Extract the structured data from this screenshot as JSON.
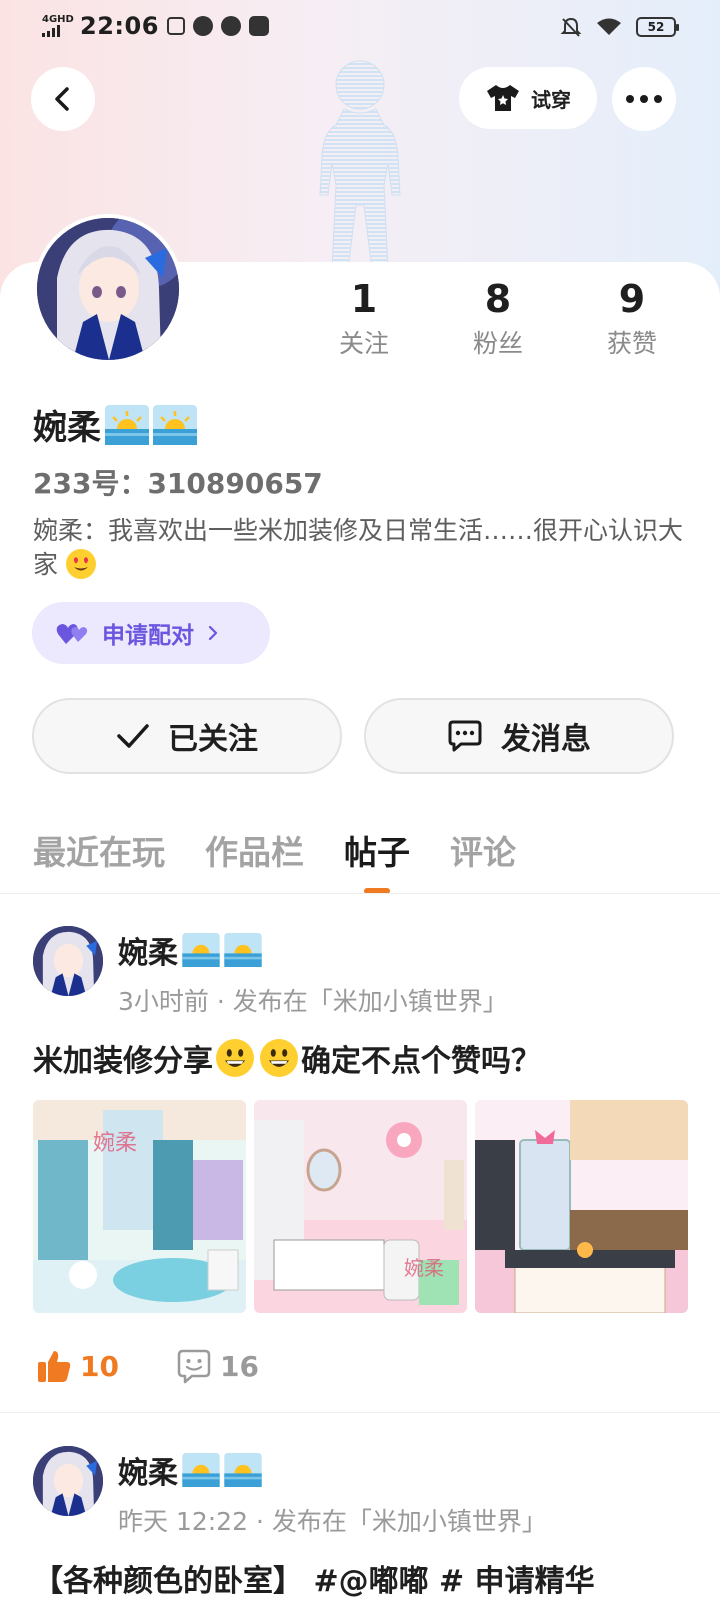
{
  "status_bar": {
    "network": "4GHD",
    "time": "22:06",
    "battery": "52"
  },
  "header": {
    "tryon_label": "试穿"
  },
  "profile": {
    "stats": [
      {
        "num": "1",
        "label": "关注"
      },
      {
        "num": "8",
        "label": "粉丝"
      },
      {
        "num": "9",
        "label": "获赞"
      }
    ],
    "name": "婉柔",
    "uid": "233号：310890657",
    "bio": "婉柔：我喜欢出一些米加装修及日常生活……很开心认识大家",
    "pair_label": "申请配对",
    "follow_label": "已关注",
    "message_label": "发消息"
  },
  "tabs": [
    "最近在玩",
    "作品栏",
    "帖子",
    "评论"
  ],
  "active_tab": "帖子",
  "posts": [
    {
      "author": "婉柔",
      "meta": "3小时前 · 发布在「米加小镇世界」",
      "title_a": "米加装修分享",
      "title_b": "确定不点个赞吗？",
      "likes": "10",
      "comments": "16"
    },
    {
      "author": "婉柔",
      "meta": "昨天 12:22 · 发布在「米加小镇世界」",
      "title": "【各种颜色的卧室】 #@嘟嘟 # 申请精华"
    }
  ],
  "colors": {
    "accent_orange": "#f07a22",
    "pair_purple": "#6b56e0",
    "pair_bg": "#ece8fd"
  }
}
